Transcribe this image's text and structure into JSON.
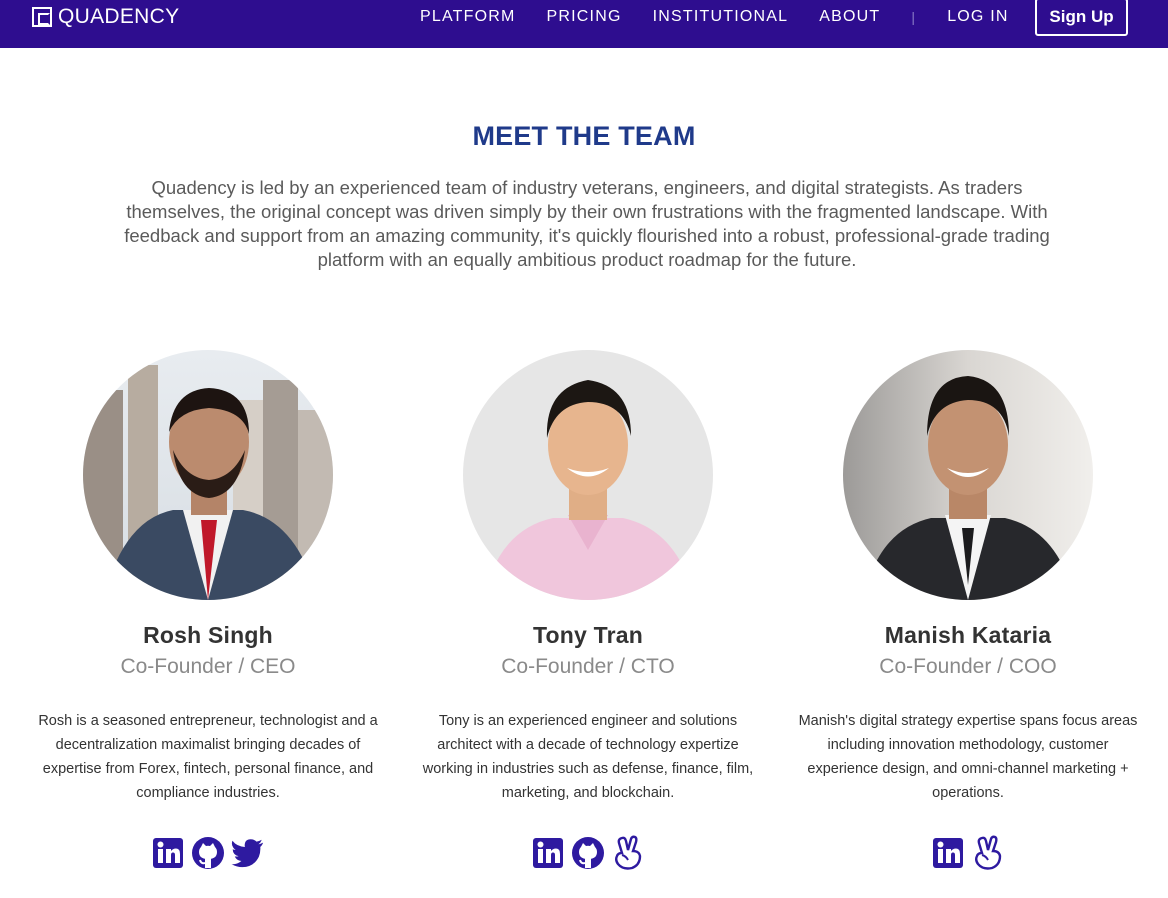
{
  "brand": {
    "name": "QUADENCY",
    "accent": "#2e0d8f",
    "heading_color": "#1f3a8a"
  },
  "nav": {
    "links": [
      "PLATFORM",
      "PRICING",
      "INSTITUTIONAL",
      "ABOUT"
    ],
    "separator": "|",
    "login": "LOG IN",
    "signup": "Sign Up"
  },
  "section": {
    "title": "MEET THE TEAM",
    "intro": "Quadency is led by an experienced team of industry veterans, engineers, and digital strategists. As traders themselves, the original concept was driven simply by their own frustrations with the fragmented landscape. With feedback and support from an amazing community, it's quickly flourished into a robust, professional-grade trading platform with an equally ambitious product roadmap for the future."
  },
  "team": [
    {
      "name": "Rosh Singh",
      "role": "Co-Founder / CEO",
      "bio": "Rosh is a seasoned entrepreneur, technologist and a decentralization maximalist bringing decades of expertise from Forex, fintech, personal finance, and compliance industries.",
      "socials": [
        "linkedin-icon",
        "github-icon",
        "twitter-icon"
      ]
    },
    {
      "name": "Tony Tran",
      "role": "Co-Founder / CTO",
      "bio": "Tony is an experienced engineer and solutions architect with a decade of technology expertize working in industries such as defense, finance, film, marketing, and blockchain.",
      "socials": [
        "linkedin-icon",
        "github-icon",
        "angellist-icon"
      ]
    },
    {
      "name": "Manish Kataria",
      "role": "Co-Founder / COO",
      "bio": "Manish's digital strategy expertise spans focus areas including innovation methodology, customer experience design, and omni-channel marketing + operations.",
      "socials": [
        "linkedin-icon",
        "angellist-icon"
      ]
    }
  ]
}
